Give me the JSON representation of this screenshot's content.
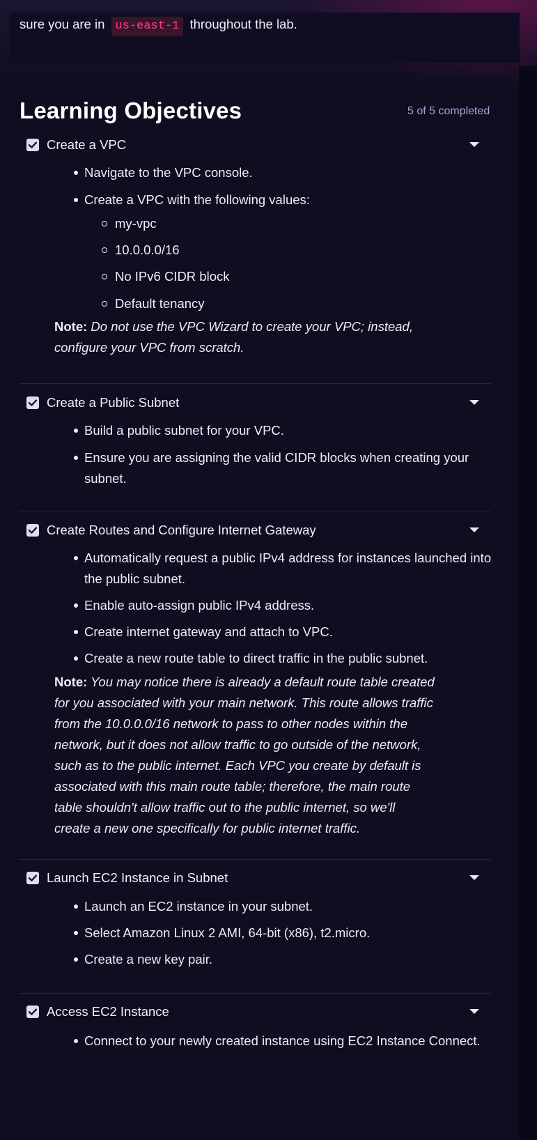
{
  "intro": {
    "text_before": "sure you are in",
    "region_code": "us-east-1",
    "text_after": "throughout the lab."
  },
  "learning_objectives": {
    "heading": "Learning Objectives",
    "progress": "5 of 5 completed",
    "objectives": [
      {
        "title": "Create a VPC",
        "checked": true,
        "bullets": [
          "Navigate to the VPC console.",
          "Create a VPC with the following values:"
        ],
        "sub_bullets": [
          "my-vpc",
          "10.0.0.0/16",
          "No IPv6 CIDR block",
          "Default tenancy"
        ],
        "note_label": "Note:",
        "note_lines": [
          "Do not use the VPC Wizard to create your VPC; instead,",
          "configure your VPC from scratch."
        ]
      },
      {
        "title": "Create a Public Subnet",
        "checked": true,
        "bullets": [
          "Build a public subnet for your VPC.",
          "Ensure you are assigning the valid CIDR blocks when creating your subnet."
        ]
      },
      {
        "title": "Create Routes and Configure Internet Gateway",
        "checked": true,
        "bullets": [
          "Automatically request a public IPv4 address for instances launched into the public subnet.",
          "Enable auto-assign public IPv4 address.",
          "Create internet gateway and attach to VPC.",
          "Create a new route table to direct traffic in the public subnet."
        ],
        "note_label": "Note:",
        "note_lines": [
          "You may notice there is already a default route table created",
          "for you associated with your main network. This route allows traffic",
          "from the 10.0.0.0/16 network to pass to other nodes within the",
          "network, but it does not allow traffic to go outside of the network,",
          "such as to the public internet. Each VPC you create by default is",
          "associated with this main route table; therefore, the main route",
          "table shouldn't allow traffic out to the public internet, so we'll",
          "create a new one specifically for public internet traffic."
        ]
      },
      {
        "title": "Launch EC2 Instance in Subnet",
        "checked": true,
        "bullets": [
          "Launch an EC2 instance in your subnet.",
          "Select Amazon Linux 2 AMI, 64-bit (x86), t2.micro.",
          "Create a new key pair."
        ]
      },
      {
        "title": "Access EC2 Instance",
        "checked": true,
        "bullets": [
          "Connect to your newly created instance using EC2 Instance Connect."
        ]
      }
    ]
  },
  "colors": {
    "background": "#0f0d1e",
    "code_text": "#ff3f7f",
    "code_bg": "#3a1428",
    "progress_text": "#a9a6d6",
    "checkbox": "#dcdcf5"
  }
}
